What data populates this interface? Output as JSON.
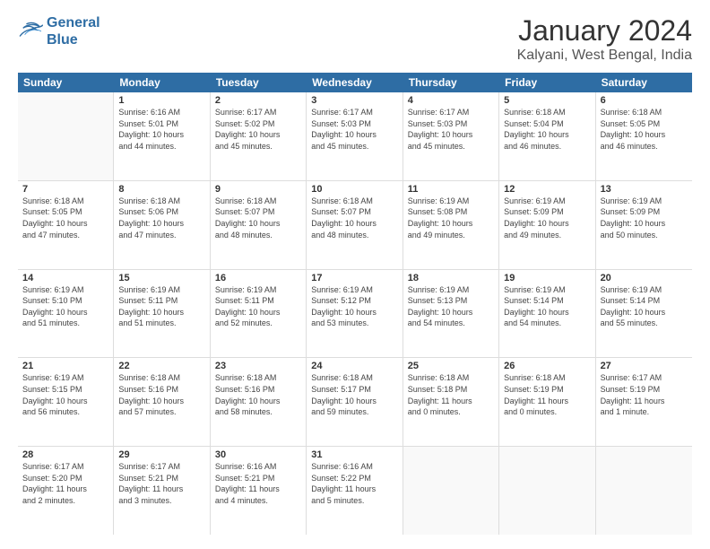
{
  "logo": {
    "line1": "General",
    "line2": "Blue"
  },
  "title": "January 2024",
  "subtitle": "Kalyani, West Bengal, India",
  "headers": [
    "Sunday",
    "Monday",
    "Tuesday",
    "Wednesday",
    "Thursday",
    "Friday",
    "Saturday"
  ],
  "weeks": [
    [
      {
        "day": "",
        "info": ""
      },
      {
        "day": "1",
        "info": "Sunrise: 6:16 AM\nSunset: 5:01 PM\nDaylight: 10 hours\nand 44 minutes."
      },
      {
        "day": "2",
        "info": "Sunrise: 6:17 AM\nSunset: 5:02 PM\nDaylight: 10 hours\nand 45 minutes."
      },
      {
        "day": "3",
        "info": "Sunrise: 6:17 AM\nSunset: 5:03 PM\nDaylight: 10 hours\nand 45 minutes."
      },
      {
        "day": "4",
        "info": "Sunrise: 6:17 AM\nSunset: 5:03 PM\nDaylight: 10 hours\nand 45 minutes."
      },
      {
        "day": "5",
        "info": "Sunrise: 6:18 AM\nSunset: 5:04 PM\nDaylight: 10 hours\nand 46 minutes."
      },
      {
        "day": "6",
        "info": "Sunrise: 6:18 AM\nSunset: 5:05 PM\nDaylight: 10 hours\nand 46 minutes."
      }
    ],
    [
      {
        "day": "7",
        "info": "Sunrise: 6:18 AM\nSunset: 5:05 PM\nDaylight: 10 hours\nand 47 minutes."
      },
      {
        "day": "8",
        "info": "Sunrise: 6:18 AM\nSunset: 5:06 PM\nDaylight: 10 hours\nand 47 minutes."
      },
      {
        "day": "9",
        "info": "Sunrise: 6:18 AM\nSunset: 5:07 PM\nDaylight: 10 hours\nand 48 minutes."
      },
      {
        "day": "10",
        "info": "Sunrise: 6:18 AM\nSunset: 5:07 PM\nDaylight: 10 hours\nand 48 minutes."
      },
      {
        "day": "11",
        "info": "Sunrise: 6:19 AM\nSunset: 5:08 PM\nDaylight: 10 hours\nand 49 minutes."
      },
      {
        "day": "12",
        "info": "Sunrise: 6:19 AM\nSunset: 5:09 PM\nDaylight: 10 hours\nand 49 minutes."
      },
      {
        "day": "13",
        "info": "Sunrise: 6:19 AM\nSunset: 5:09 PM\nDaylight: 10 hours\nand 50 minutes."
      }
    ],
    [
      {
        "day": "14",
        "info": "Sunrise: 6:19 AM\nSunset: 5:10 PM\nDaylight: 10 hours\nand 51 minutes."
      },
      {
        "day": "15",
        "info": "Sunrise: 6:19 AM\nSunset: 5:11 PM\nDaylight: 10 hours\nand 51 minutes."
      },
      {
        "day": "16",
        "info": "Sunrise: 6:19 AM\nSunset: 5:11 PM\nDaylight: 10 hours\nand 52 minutes."
      },
      {
        "day": "17",
        "info": "Sunrise: 6:19 AM\nSunset: 5:12 PM\nDaylight: 10 hours\nand 53 minutes."
      },
      {
        "day": "18",
        "info": "Sunrise: 6:19 AM\nSunset: 5:13 PM\nDaylight: 10 hours\nand 54 minutes."
      },
      {
        "day": "19",
        "info": "Sunrise: 6:19 AM\nSunset: 5:14 PM\nDaylight: 10 hours\nand 54 minutes."
      },
      {
        "day": "20",
        "info": "Sunrise: 6:19 AM\nSunset: 5:14 PM\nDaylight: 10 hours\nand 55 minutes."
      }
    ],
    [
      {
        "day": "21",
        "info": "Sunrise: 6:19 AM\nSunset: 5:15 PM\nDaylight: 10 hours\nand 56 minutes."
      },
      {
        "day": "22",
        "info": "Sunrise: 6:18 AM\nSunset: 5:16 PM\nDaylight: 10 hours\nand 57 minutes."
      },
      {
        "day": "23",
        "info": "Sunrise: 6:18 AM\nSunset: 5:16 PM\nDaylight: 10 hours\nand 58 minutes."
      },
      {
        "day": "24",
        "info": "Sunrise: 6:18 AM\nSunset: 5:17 PM\nDaylight: 10 hours\nand 59 minutes."
      },
      {
        "day": "25",
        "info": "Sunrise: 6:18 AM\nSunset: 5:18 PM\nDaylight: 11 hours\nand 0 minutes."
      },
      {
        "day": "26",
        "info": "Sunrise: 6:18 AM\nSunset: 5:19 PM\nDaylight: 11 hours\nand 0 minutes."
      },
      {
        "day": "27",
        "info": "Sunrise: 6:17 AM\nSunset: 5:19 PM\nDaylight: 11 hours\nand 1 minute."
      }
    ],
    [
      {
        "day": "28",
        "info": "Sunrise: 6:17 AM\nSunset: 5:20 PM\nDaylight: 11 hours\nand 2 minutes."
      },
      {
        "day": "29",
        "info": "Sunrise: 6:17 AM\nSunset: 5:21 PM\nDaylight: 11 hours\nand 3 minutes."
      },
      {
        "day": "30",
        "info": "Sunrise: 6:16 AM\nSunset: 5:21 PM\nDaylight: 11 hours\nand 4 minutes."
      },
      {
        "day": "31",
        "info": "Sunrise: 6:16 AM\nSunset: 5:22 PM\nDaylight: 11 hours\nand 5 minutes."
      },
      {
        "day": "",
        "info": ""
      },
      {
        "day": "",
        "info": ""
      },
      {
        "day": "",
        "info": ""
      }
    ]
  ]
}
